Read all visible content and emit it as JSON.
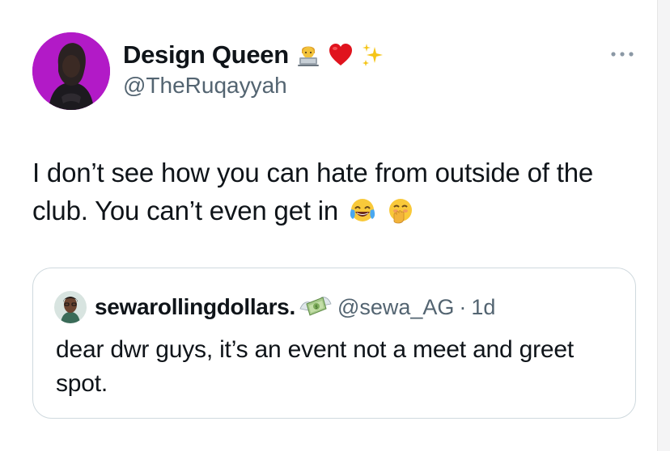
{
  "author": {
    "display_name": "Design Queen",
    "handle": "@TheRuqayyah",
    "name_icons": [
      "technologist-icon",
      "red-heart-icon",
      "sparkles-icon"
    ]
  },
  "tweet": {
    "text": "I don’t see how you can hate from outside of the club. You can’t even get in",
    "trailing_icons": [
      "face-with-tears-of-joy-icon",
      "face-with-hand-over-mouth-icon"
    ]
  },
  "quote": {
    "display_name": "sewarollingdollars.",
    "name_icon": "money-with-wings-icon",
    "handle": "@sewa_AG",
    "separator": "·",
    "time": "1d",
    "text": "dear dwr guys, it’s an event not a meet and greet spot."
  },
  "colors": {
    "avatar_bg": "#b21ac7",
    "text_primary": "#0f1419",
    "text_secondary": "#536471",
    "border": "#cfd9de"
  }
}
